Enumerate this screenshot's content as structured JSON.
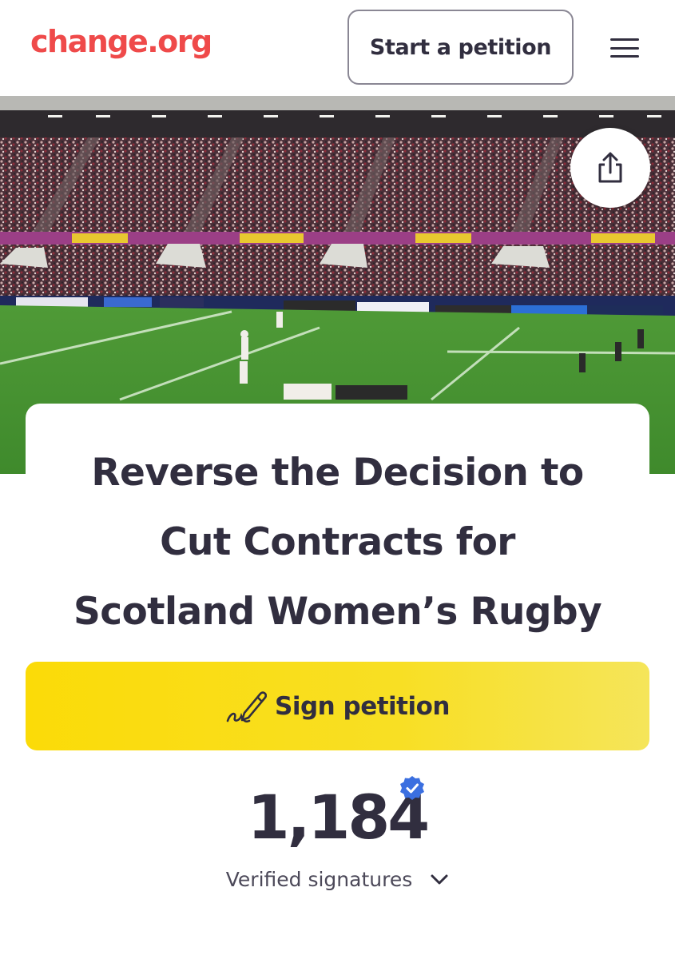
{
  "header": {
    "logo": "change.org",
    "start_petition": "Start a petition",
    "menu_icon": "hamburger-menu-icon"
  },
  "hero": {
    "share_icon": "share-icon"
  },
  "petition": {
    "title_lines": [
      "Reverse the Decision to",
      "Cut Contracts for",
      "Scotland Women’s Rugby"
    ],
    "sign_label": "Sign petition",
    "sign_icon": "signature-pen-icon",
    "signature_count": "1,184",
    "verified_icon": "verified-check-icon",
    "verified_label": "Verified signatures",
    "expand_icon": "chevron-down-icon"
  },
  "colors": {
    "brand": "#ef4a4a",
    "text": "#312e3f",
    "sign_button": "#fbdb08",
    "verified": "#3b6fe0"
  }
}
